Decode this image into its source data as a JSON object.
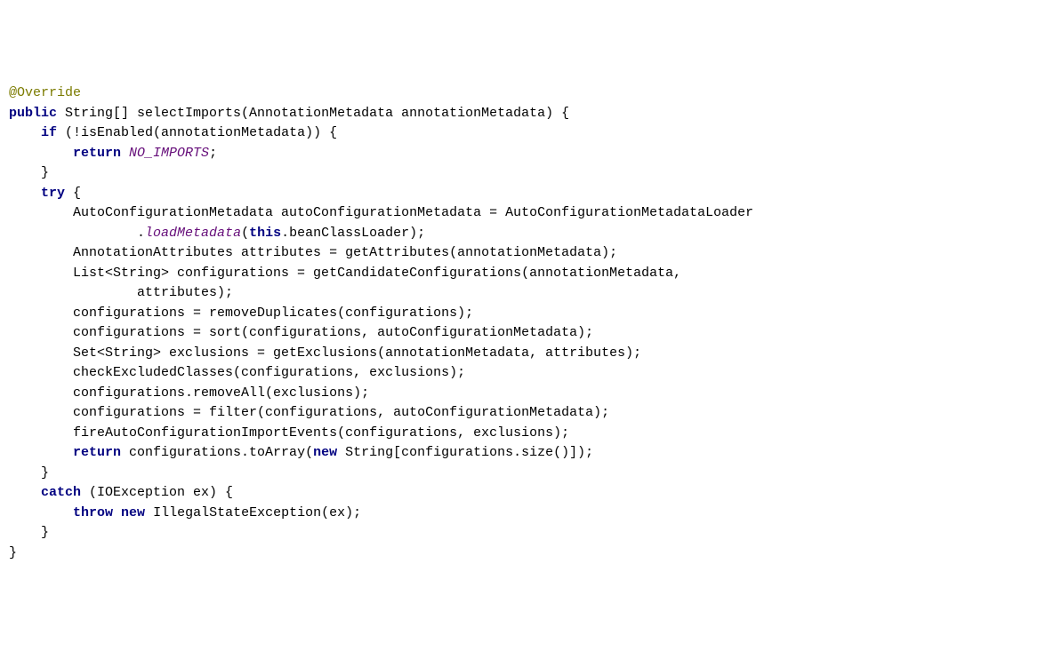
{
  "code": {
    "l1_ann": "@Override",
    "l2_kw": "public",
    "l2_rest": " String[] selectImports(AnnotationMetadata annotationMetadata) {",
    "l3_kw": "if",
    "l3_rest": " (!isEnabled(annotationMetadata)) {",
    "l4_kw": "return",
    "l4_stat": "NO_IMPORTS",
    "l4_sc": ";",
    "l5": "}",
    "l6_kw": "try",
    "l6_rest": " {",
    "l7": "AutoConfigurationMetadata autoConfigurationMetadata = AutoConfigurationMetadataLoader",
    "l8_a": ".",
    "l8_m": "loadMetadata",
    "l8_b": "(",
    "l8_kw": "this",
    "l8_c": ".beanClassLoader);",
    "l9": "AnnotationAttributes attributes = getAttributes(annotationMetadata);",
    "l10": "List<String> configurations = getCandidateConfigurations(annotationMetadata,",
    "l11": "attributes);",
    "l12": "configurations = removeDuplicates(configurations);",
    "l13": "configurations = sort(configurations, autoConfigurationMetadata);",
    "l14": "Set<String> exclusions = getExclusions(annotationMetadata, attributes);",
    "l15": "checkExcludedClasses(configurations, exclusions);",
    "l16": "configurations.removeAll(exclusions);",
    "l17": "configurations = filter(configurations, autoConfigurationMetadata);",
    "l18": "fireAutoConfigurationImportEvents(configurations, exclusions);",
    "l19_kw": "return",
    "l19_a": " configurations.toArray(",
    "l19_kw2": "new",
    "l19_b": " String[configurations.size()]);",
    "l20": "}",
    "l21_kw": "catch",
    "l21_rest": " (IOException ex) {",
    "l22_kw1": "throw",
    "l22_kw2": "new",
    "l22_rest": " IllegalStateException(ex);",
    "l23": "}",
    "l24": "}"
  }
}
